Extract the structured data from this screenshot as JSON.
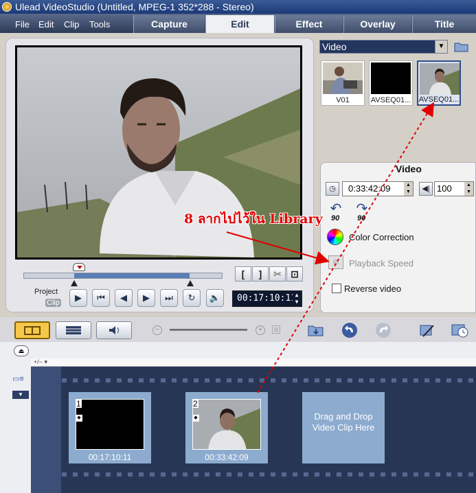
{
  "window": {
    "title": "Ulead VideoStudio (Untitled, MPEG-1 352*288 - Stereo)"
  },
  "menu": [
    "File",
    "Edit",
    "Clip",
    "Tools"
  ],
  "steps": [
    {
      "label": "Capture"
    },
    {
      "label": "Edit"
    },
    {
      "label": "Effect"
    },
    {
      "label": "Overlay"
    },
    {
      "label": "Title"
    }
  ],
  "active_step": "Edit",
  "preview": {
    "mode_project": "Project",
    "mode_clip": "Clip",
    "timecode": "00:17:10:11",
    "buttons": {
      "mark_in": "[",
      "mark_out": "]",
      "cut": "✂",
      "enlarge": "⊡"
    }
  },
  "library": {
    "category": "Video",
    "items": [
      {
        "label": "V01"
      },
      {
        "label": "AVSEQ01..."
      },
      {
        "label": "AVSEQ01..."
      }
    ]
  },
  "options": {
    "title": "Video",
    "duration": "0:33:42:09",
    "volume": "100",
    "rotate_left": "90",
    "rotate_right": "90",
    "color_correction": "Color Correction",
    "playback_speed": "Playback Speed",
    "reverse_video": "Reverse video"
  },
  "timeline": {
    "ruler_label": "+/− ▾",
    "clips": [
      {
        "index": "1",
        "duration": "00:17:10:11"
      },
      {
        "index": "2",
        "duration": "00:33:42:09"
      }
    ],
    "drop_hint": "Drag and Drop Video Clip Here"
  },
  "annotation": {
    "text": "8 ลากไปไว้ใน Library",
    "color": "#e00000"
  },
  "colors": {
    "accent": "#2c3a56",
    "film": "#283656",
    "clip": "#8cabcf"
  }
}
